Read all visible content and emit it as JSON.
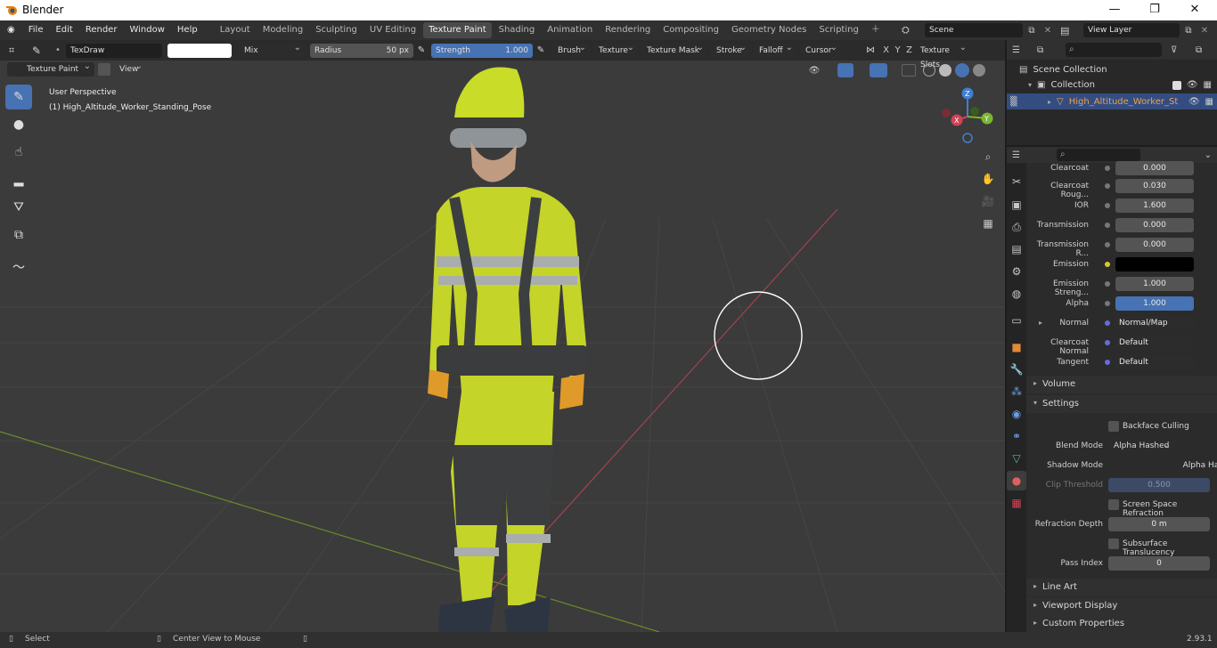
{
  "window": {
    "title": "Blender",
    "min": "—",
    "max": "❐",
    "close": "✕"
  },
  "menu": [
    "File",
    "Edit",
    "Render",
    "Window",
    "Help"
  ],
  "workspaces": [
    "Layout",
    "Modeling",
    "Sculpting",
    "UV Editing",
    "Texture Paint",
    "Shading",
    "Animation",
    "Rendering",
    "Compositing",
    "Geometry Nodes",
    "Scripting"
  ],
  "active_workspace": "Texture Paint",
  "scene": {
    "label": "Scene",
    "view_layer": "View Layer"
  },
  "toolbar": {
    "brush": "TexDraw",
    "blend": "Mix",
    "radius_label": "Radius",
    "radius_value": "50 px",
    "strength_label": "Strength",
    "strength_value": "1.000",
    "menus": [
      "Brush",
      "Texture",
      "Texture Mask",
      "Stroke",
      "Falloff",
      "Cursor"
    ],
    "axes": [
      "X",
      "Y",
      "Z"
    ],
    "texture_slots": "Texture Slots"
  },
  "viewport_header": {
    "mode": "Texture Paint",
    "view": "View"
  },
  "viewport": {
    "perspective": "User Perspective",
    "object": "(1) High_Altitude_Worker_Standing_Pose",
    "gizmo": {
      "x": "X",
      "y": "Y",
      "z": "Z"
    }
  },
  "outliner": {
    "scene_collection": "Scene Collection",
    "collection": "Collection",
    "object": "High_Altitude_Worker_St"
  },
  "properties": {
    "rows": [
      {
        "label": "Clearcoat",
        "value": "0.000"
      },
      {
        "label": "Clearcoat Roug...",
        "value": "0.030"
      },
      {
        "label": "IOR",
        "value": "1.600"
      },
      {
        "label": "Transmission",
        "value": "0.000"
      },
      {
        "label": "Transmission R...",
        "value": "0.000"
      },
      {
        "label": "Emission",
        "value": ""
      },
      {
        "label": "Emission Streng...",
        "value": "1.000"
      },
      {
        "label": "Alpha",
        "value": "1.000"
      },
      {
        "label": "Normal",
        "value": "Normal/Map"
      },
      {
        "label": "Clearcoat Normal",
        "value": "Default"
      },
      {
        "label": "Tangent",
        "value": "Default"
      }
    ],
    "volume": "Volume",
    "settings": "Settings",
    "backface": "Backface Culling",
    "blend_mode_label": "Blend Mode",
    "blend_mode": "Alpha Hashed",
    "shadow_mode_label": "Shadow Mode",
    "shadow_mode": "Alpha Hashed",
    "clip_label": "Clip Threshold",
    "clip_value": "0.500",
    "ssr": "Screen Space Refraction",
    "refraction_label": "Refraction Depth",
    "refraction_value": "0 m",
    "sss": "Subsurface Translucency",
    "pass_label": "Pass Index",
    "pass_value": "0",
    "line_art": "Line Art",
    "viewport_display": "Viewport Display",
    "custom_props": "Custom Properties"
  },
  "status": {
    "left": "Select",
    "middle": "Center View to Mouse",
    "version": "2.93.1"
  },
  "colors": {
    "accent": "#4772b3",
    "hivis": "#c8dc28",
    "active_tab": "#4a4a4a"
  }
}
